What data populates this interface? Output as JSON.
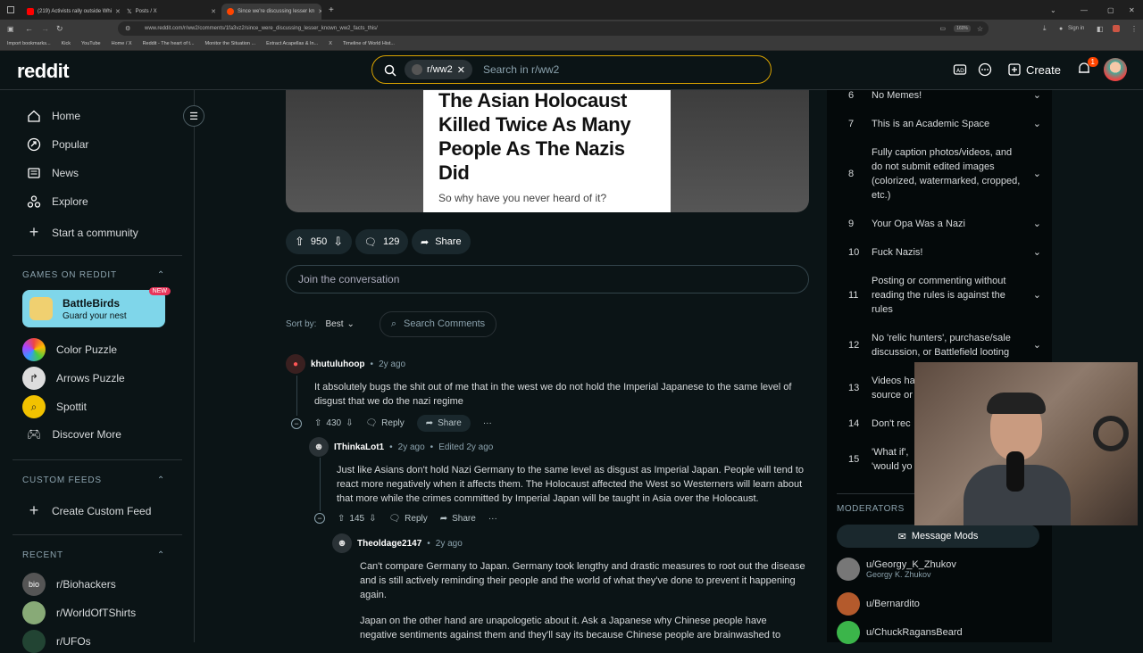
{
  "browser": {
    "tabs": [
      {
        "title": "(219) Activists rally outside Whi",
        "color": "#ff0000",
        "active": false
      },
      {
        "title": "Posts / X",
        "color": "#ffffff",
        "active": false
      },
      {
        "title": "Since we're discussing lesser kn",
        "color": "#ff4500",
        "active": true
      }
    ],
    "url": "www.reddit.com/r/ww2/comments/1fa3vz2/since_were_discussing_lesser_known_ww2_facts_this/",
    "zoom": "160%",
    "signin": "Sign in",
    "bookmarks": [
      "Import bookmarks...",
      "Kick",
      "YouTube",
      "Home / X",
      "Reddit - The heart of t...",
      "Monitor the Situation ...",
      "Extract Acapellas & In...",
      "X",
      "Timeline of World Hist..."
    ]
  },
  "header": {
    "logo": "reddit",
    "search_chip": "r/ww2",
    "search_placeholder": "Search in r/ww2",
    "create_label": "Create",
    "notif_count": "1"
  },
  "sidebar": {
    "nav": [
      {
        "label": "Home",
        "icon": "home-icon"
      },
      {
        "label": "Popular",
        "icon": "popular-icon"
      },
      {
        "label": "News",
        "icon": "news-icon"
      },
      {
        "label": "Explore",
        "icon": "explore-icon"
      },
      {
        "label": "Start a community",
        "icon": "plus-icon"
      }
    ],
    "games_header": "GAMES ON REDDIT",
    "featured_game": {
      "title": "BattleBirds",
      "subtitle": "Guard your nest",
      "badge": "NEW"
    },
    "games": [
      "Color Puzzle",
      "Arrows Puzzle",
      "Spottit",
      "Discover More"
    ],
    "custom_feeds_header": "CUSTOM FEEDS",
    "create_feed": "Create Custom Feed",
    "recent_header": "RECENT",
    "recent": [
      "r/Biohackers",
      "r/WorldOfTShirts",
      "r/UFOs"
    ]
  },
  "post": {
    "image_title": "The Asian Holocaust Killed Twice As Many People As The Nazis Did",
    "image_subtitle": "So why have you never heard of it?",
    "votes": "950",
    "comments": "129",
    "share": "Share",
    "join_placeholder": "Join the conversation",
    "sort_label": "Sort by:",
    "sort_value": "Best",
    "search_comments": "Search Comments"
  },
  "comments": [
    {
      "user": "khutuluhoop",
      "time": "2y ago",
      "edited": "",
      "text": "It absolutely bugs the shit out of me that in the west we do not hold the Imperial Japanese to the same level of disgust that we do the nazi regime",
      "votes": "430",
      "reply": "Reply",
      "share": "Share"
    },
    {
      "user": "IThinkaLot1",
      "time": "2y ago",
      "edited": "Edited 2y ago",
      "text": "Just like Asians don't hold Nazi Germany to the same level as disgust as Imperial Japan. People will tend to react more negatively when it affects them. The Holocaust affected the West so Westerners will learn about that more while the crimes committed by Imperial Japan will be taught in Asia over the Holocaust.",
      "votes": "145",
      "reply": "Reply",
      "share": "Share"
    },
    {
      "user": "Theoldage2147",
      "time": "2y ago",
      "edited": "",
      "text": "Can't compare Germany to Japan. Germany took lengthy and drastic measures to root out the disease and is still actively reminding their people and the world of what they've done to prevent it happening again.",
      "text2": "Japan on the other hand are unapologetic about it. Ask a Japanese why Chinese people have negative sentiments against them and they'll say its because Chinese people are brainwashed to"
    }
  ],
  "rules": [
    {
      "num": "6",
      "text": "No Memes!"
    },
    {
      "num": "7",
      "text": "This is an Academic Space"
    },
    {
      "num": "8",
      "text": "Fully caption photos/videos, and do not submit edited images (colorized, watermarked, cropped, etc.)"
    },
    {
      "num": "9",
      "text": "Your Opa Was a Nazi"
    },
    {
      "num": "10",
      "text": "Fuck Nazis!"
    },
    {
      "num": "11",
      "text": "Posting or commenting without reading the rules is against the rules"
    },
    {
      "num": "12",
      "text": "No 'relic hunters', purchase/sale discussion, or Battlefield looting"
    },
    {
      "num": "13",
      "text": "Videos ha source or"
    },
    {
      "num": "14",
      "text": "Don't rec"
    },
    {
      "num": "15",
      "text": "'What if', 'would yo"
    }
  ],
  "moderators": {
    "header": "MODERATORS",
    "message_button": "Message Mods",
    "list": [
      {
        "name": "u/Georgy_K_Zhukov",
        "flair": "Georgy K. Zhukov"
      },
      {
        "name": "u/Bernardito",
        "flair": ""
      },
      {
        "name": "u/ChuckRagansBeard",
        "flair": ""
      }
    ]
  },
  "colors": {
    "bg": "#0b1416",
    "accent_search": "#d9a300",
    "reddit_orange": "#ff4500",
    "game_card": "#7fd6ea"
  }
}
